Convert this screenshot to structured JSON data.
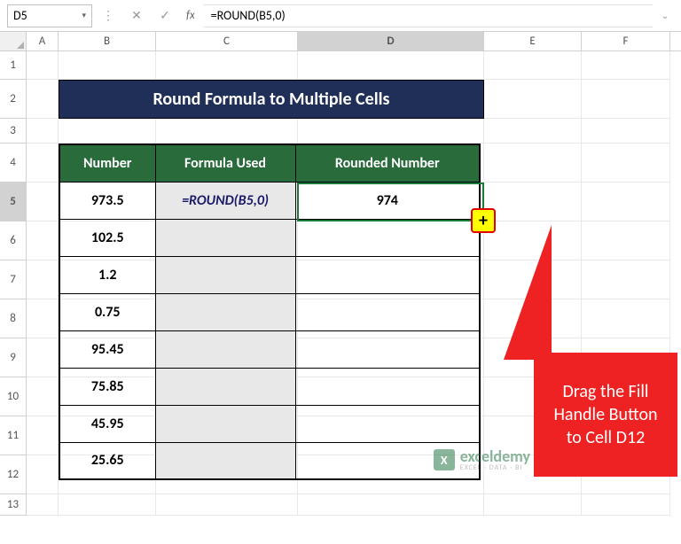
{
  "nameBox": "D5",
  "formulaBar": "=ROUND(B5,0)",
  "columns": [
    "A",
    "B",
    "C",
    "D",
    "E",
    "F"
  ],
  "activeCol": "D",
  "rows": [
    "1",
    "2",
    "3",
    "4",
    "5",
    "6",
    "7",
    "8",
    "9",
    "10",
    "11",
    "12",
    "13"
  ],
  "activeRow": "5",
  "title": "Round Formula to Multiple Cells",
  "headers": {
    "b": "Number",
    "c": "Formula Used",
    "d": "Rounded Number"
  },
  "data": [
    {
      "num": "973.5",
      "formula": "=ROUND(B5,0)",
      "result": "974"
    },
    {
      "num": "102.5",
      "formula": "",
      "result": ""
    },
    {
      "num": "1.2",
      "formula": "",
      "result": ""
    },
    {
      "num": "0.75",
      "formula": "",
      "result": ""
    },
    {
      "num": "95.45",
      "formula": "",
      "result": ""
    },
    {
      "num": "75.85",
      "formula": "",
      "result": ""
    },
    {
      "num": "45.95",
      "formula": "",
      "result": ""
    },
    {
      "num": "25.65",
      "formula": "",
      "result": ""
    }
  ],
  "callout": "Drag the Fill Handle Button to Cell D12",
  "watermark": {
    "main": "exceldemy",
    "sub": "EXCEL · DATA · BI"
  },
  "icons": {
    "dropdown": "▾",
    "cancel": "✕",
    "enter": "✓",
    "fx": "fx",
    "expand": "⌄",
    "plus": "+"
  }
}
